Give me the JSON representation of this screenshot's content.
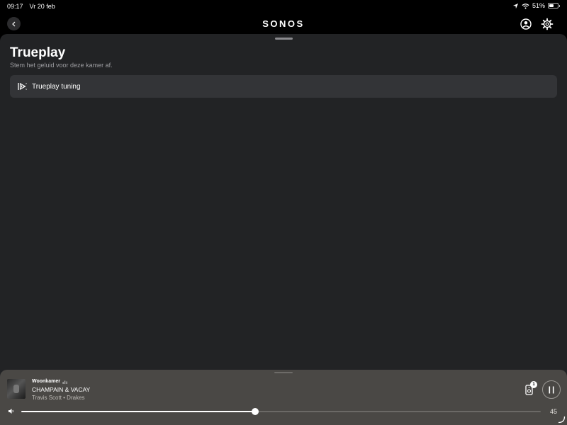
{
  "status_bar": {
    "time": "09:17",
    "date": "Vr 20 feb",
    "battery_text": "51%",
    "battery_level": 0.51
  },
  "header": {
    "logo": "SONOS"
  },
  "page": {
    "title": "Trueplay",
    "subtitle": "Stem het geluid voor deze kamer af.",
    "items": [
      {
        "label": "Trueplay tuning",
        "icon": "trueplay-icon"
      }
    ]
  },
  "player": {
    "room": "Woonkamer",
    "track": "CHAMPAIN & VACAY",
    "artist": "Travis Scott • Drakes",
    "speaker_badge": "1",
    "volume": 45,
    "volume_level": 0.45
  },
  "colors": {
    "sheet": "#222325",
    "row": "#333437",
    "player": "#4a4845",
    "accent": "#ffffff"
  }
}
